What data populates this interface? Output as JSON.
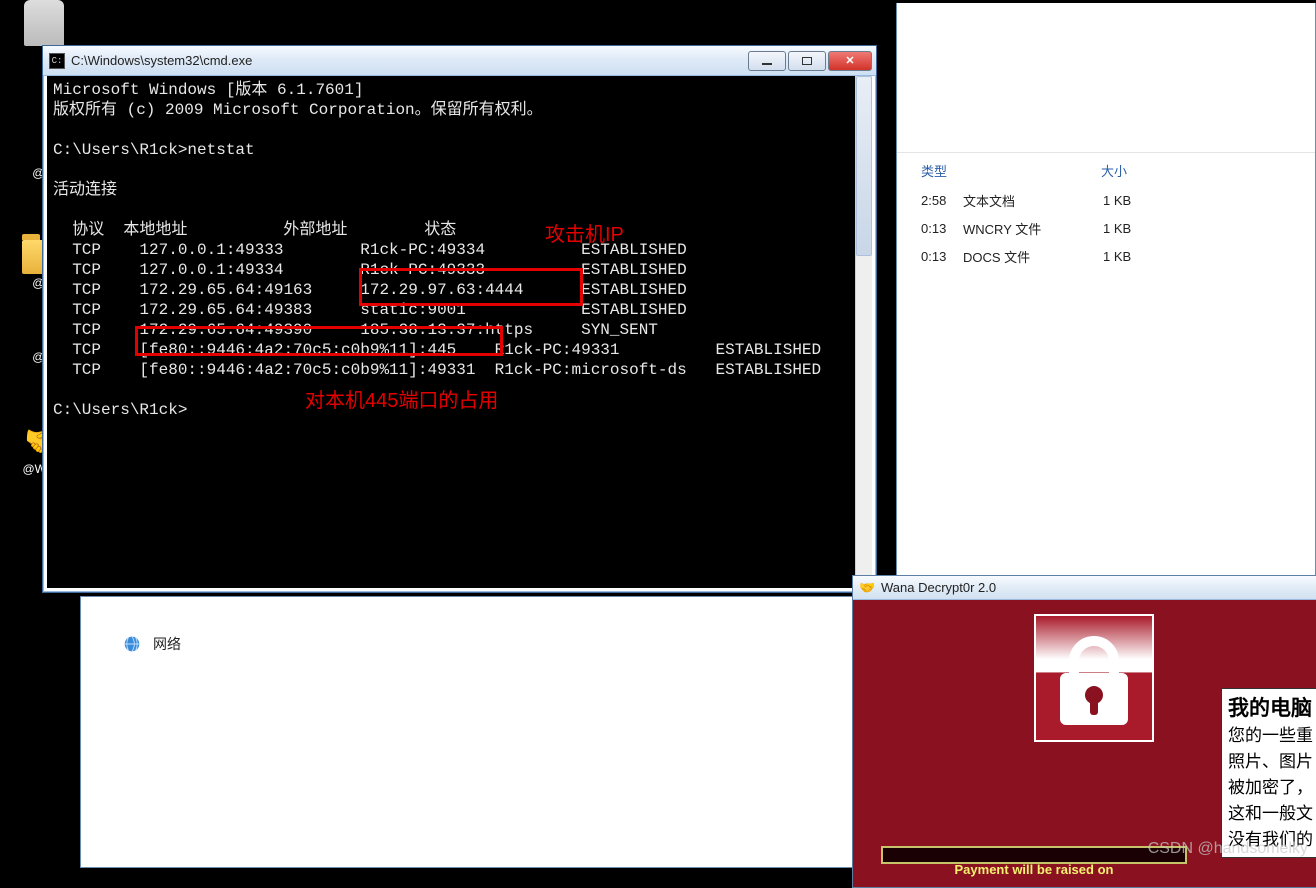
{
  "desktop": {
    "icons": [
      {
        "label": "",
        "img": "trash"
      },
      {
        "label": "@W",
        "img": ""
      },
      {
        "label": "@W",
        "img": "folder"
      },
      {
        "label": "@W",
        "img": ""
      },
      {
        "label": "@Wana",
        "img": "hands"
      }
    ]
  },
  "explorer": {
    "columns": {
      "type_hdr": "类型",
      "size_hdr": "大小"
    },
    "rows": [
      {
        "time": "2:58",
        "type": "文本文档",
        "size": "1 KB"
      },
      {
        "time": "0:13",
        "type": "WNCRY 文件",
        "size": "1 KB"
      },
      {
        "time": "0:13",
        "type": "DOCS 文件",
        "size": "1 KB"
      }
    ],
    "network_label": "网络"
  },
  "cmd": {
    "title": "C:\\Windows\\system32\\cmd.exe",
    "lines": [
      "Microsoft Windows [版本 6.1.7601]",
      "版权所有 (c) 2009 Microsoft Corporation。保留所有权利。",
      "",
      "C:\\Users\\R1ck>netstat",
      "",
      "活动连接",
      "",
      "  协议  本地地址          外部地址        状态",
      "  TCP    127.0.0.1:49333    R1ck-PC:49334      ESTABLISHED",
      "  TCP    127.0.0.1:49334    R1ck-PC:49333      ESTABLISHED",
      "  TCP    172.29.65.64:49163    172.29.97.63:4444      ESTABLISHED",
      "  TCP    172.29.65.64:49383    static:9001      ESTABLISHED",
      "  TCP    172.29.65.64:49390    185.38.13.37:https      SYN_SENT",
      "  TCP    [fe80::9446:4a2:70c5:c0b9%11]:445    R1ck-PC:49331      ESTABLISHED",
      "  TCP    [fe80::9446:4a2:70c5:c0b9%11]:49331    R1ck-PC:microsoft-ds      ESTABLISHED",
      "",
      "C:\\Users\\R1ck>"
    ],
    "annotations": {
      "attacker_ip_label": "攻击机IP",
      "port445_label": "对本机445端口的占用"
    }
  },
  "wana": {
    "title": "Wana Decrypt0r 2.0",
    "panel_heading": "我的电脑",
    "panel_lines": [
      "您的一些重",
      "照片、图片",
      "被加密了，",
      "这和一般文",
      "没有我们的"
    ],
    "payment_text": "Payment will be raised on"
  },
  "watermark": "CSDN @handsomelky"
}
